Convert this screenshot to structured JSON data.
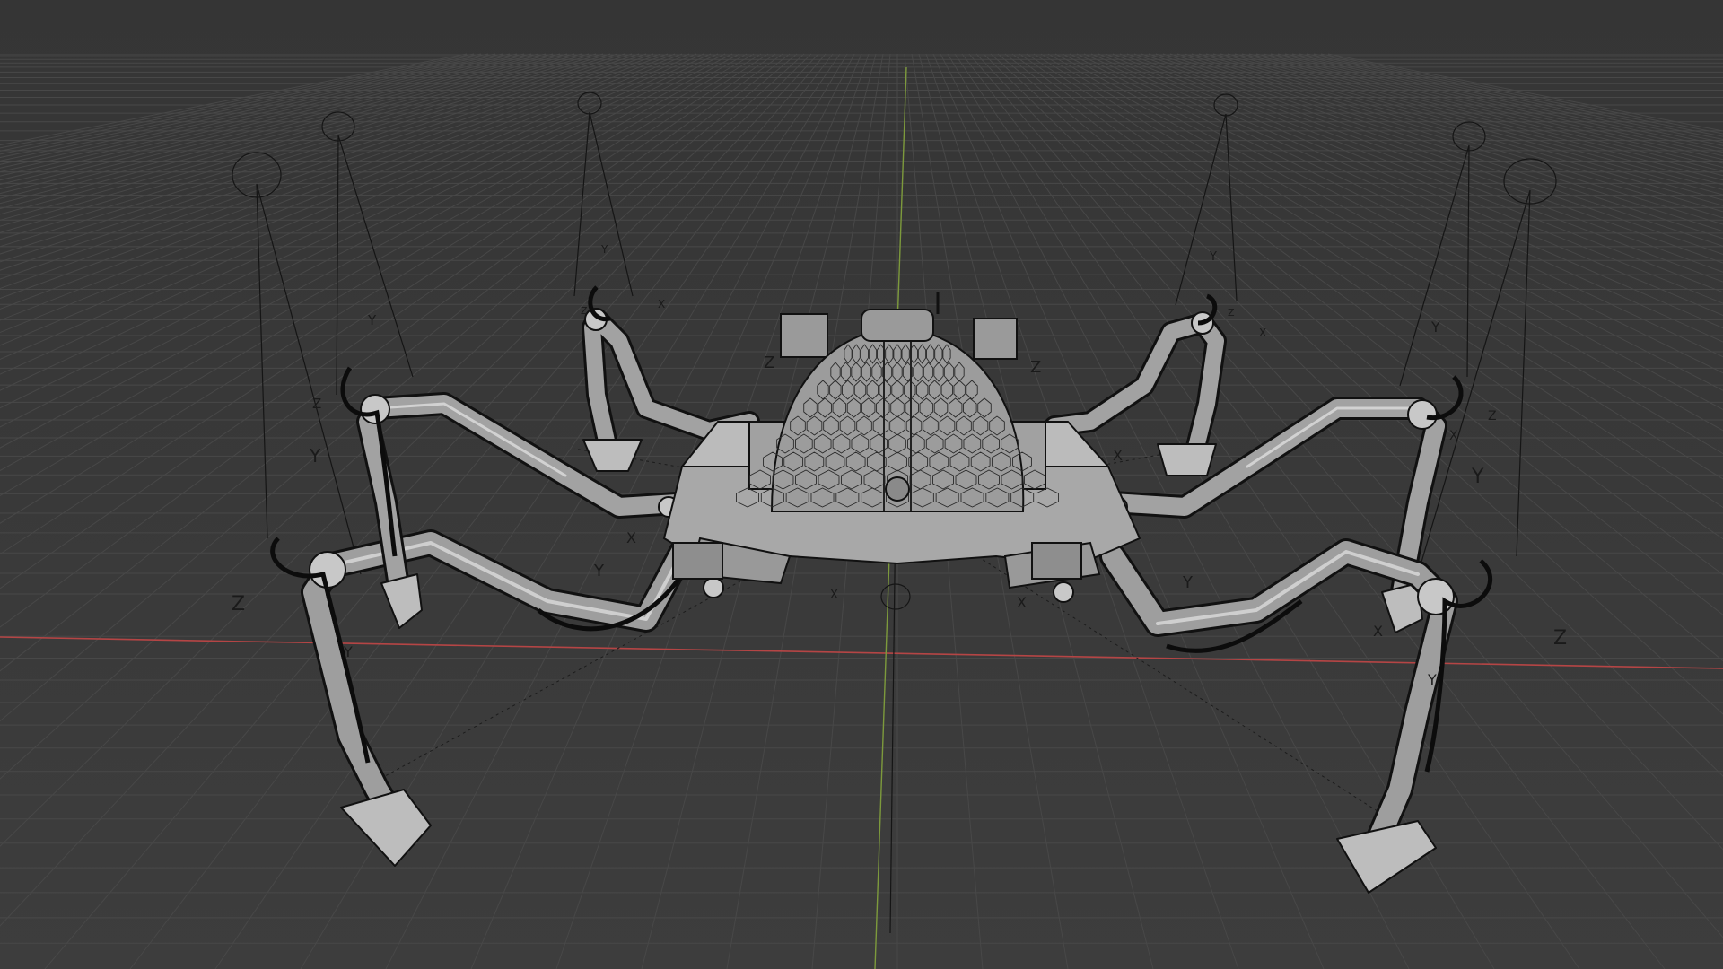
{
  "viewport": {
    "background": "#3a3a3a",
    "grid_color": "#4a4a4a",
    "x_axis_color": "#c24a4a",
    "y_axis_color": "#7a9a3a",
    "wire_color": "#111111",
    "mesh_color": "#a6a6a6"
  },
  "scene": {
    "object": "hexapod-robot-spider",
    "bone_axis_labels": {
      "x": "X",
      "y": "Y",
      "z": "Z"
    }
  }
}
